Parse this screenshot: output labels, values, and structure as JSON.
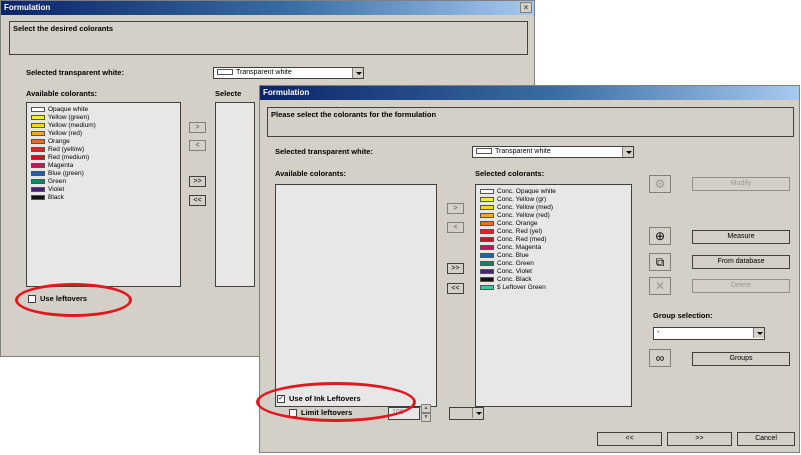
{
  "back": {
    "title": "Formulation",
    "close_glyph": "×",
    "instruction": "Select the desired colorants",
    "transparent_white_label": "Selected transparent white:",
    "transparent_white_value": "Transparent white",
    "available_label": "Available colorants:",
    "selected_label": "Selecte",
    "available": [
      {
        "name": "Opaque white",
        "color": "#ffffff"
      },
      {
        "name": "Yellow (green)",
        "color": "#f2ef2b"
      },
      {
        "name": "Yellow (medium)",
        "color": "#f8d719"
      },
      {
        "name": "Yellow (red)",
        "color": "#f7a91b"
      },
      {
        "name": "Orange",
        "color": "#f26b1d"
      },
      {
        "name": "Red (yellow)",
        "color": "#e0231d"
      },
      {
        "name": "Red (medium)",
        "color": "#c9151c"
      },
      {
        "name": "Magenta",
        "color": "#c2185b"
      },
      {
        "name": "Blue (green)",
        "color": "#1f5fb5"
      },
      {
        "name": "Green",
        "color": "#12875d"
      },
      {
        "name": "Violet",
        "color": "#4a1e7a"
      },
      {
        "name": "Black",
        "color": "#111111"
      }
    ],
    "arrows": [
      ">",
      "<",
      ">>",
      "<<"
    ],
    "use_leftovers": "Use leftovers"
  },
  "front": {
    "title": "Formulation",
    "instruction": "Please select the colorants for the formulation",
    "transparent_white_label": "Selected transparent white:",
    "transparent_white_value": "Transparent white",
    "available_label": "Available colorants:",
    "selected_label": "Selected colorants:",
    "selected": [
      {
        "name": "Conc. Opaque white",
        "color": "#ffffff"
      },
      {
        "name": "Conc. Yellow (gr)",
        "color": "#f2ef2b"
      },
      {
        "name": "Conc. Yellow (med)",
        "color": "#f8d719"
      },
      {
        "name": "Conc. Yellow (red)",
        "color": "#f7a91b"
      },
      {
        "name": "Conc. Orange",
        "color": "#f26b1d"
      },
      {
        "name": "Conc. Red (yel)",
        "color": "#e0231d"
      },
      {
        "name": "Conc. Red (med)",
        "color": "#c9151c"
      },
      {
        "name": "Conc. Magenta",
        "color": "#c2185b"
      },
      {
        "name": "Conc. Blue",
        "color": "#1f5fb5"
      },
      {
        "name": "Conc. Green",
        "color": "#12875d"
      },
      {
        "name": "Conc. Violet",
        "color": "#4a1e7a"
      },
      {
        "name": "Conc. Black",
        "color": "#111111"
      },
      {
        "name": "$ Leftover Green",
        "color": "#2bd1a6"
      }
    ],
    "arrows": [
      ">",
      "<",
      ">>",
      "<<"
    ],
    "modify": "Modify",
    "measure": "Measure",
    "from_database": "From database",
    "delete": "Delete",
    "group_selection_label": "Group selection:",
    "group_selection_value": "-",
    "groups": "Groups",
    "use_ink_leftovers": "Use of Ink Leftovers",
    "use_ink_leftovers_mark": "✓",
    "limit_leftovers": "Limit leftovers",
    "limit_value": "100",
    "spin_up": "▲",
    "spin_down": "▼",
    "back_btn": "<<",
    "next_btn": ">>",
    "cancel": "Cancel",
    "icons": {
      "modify": "gear-icon",
      "measure": "crosshair-icon",
      "from_database": "copy-icon",
      "delete": "x-icon",
      "groups": "groups-icon"
    }
  },
  "highlight_color": "#e2171f"
}
